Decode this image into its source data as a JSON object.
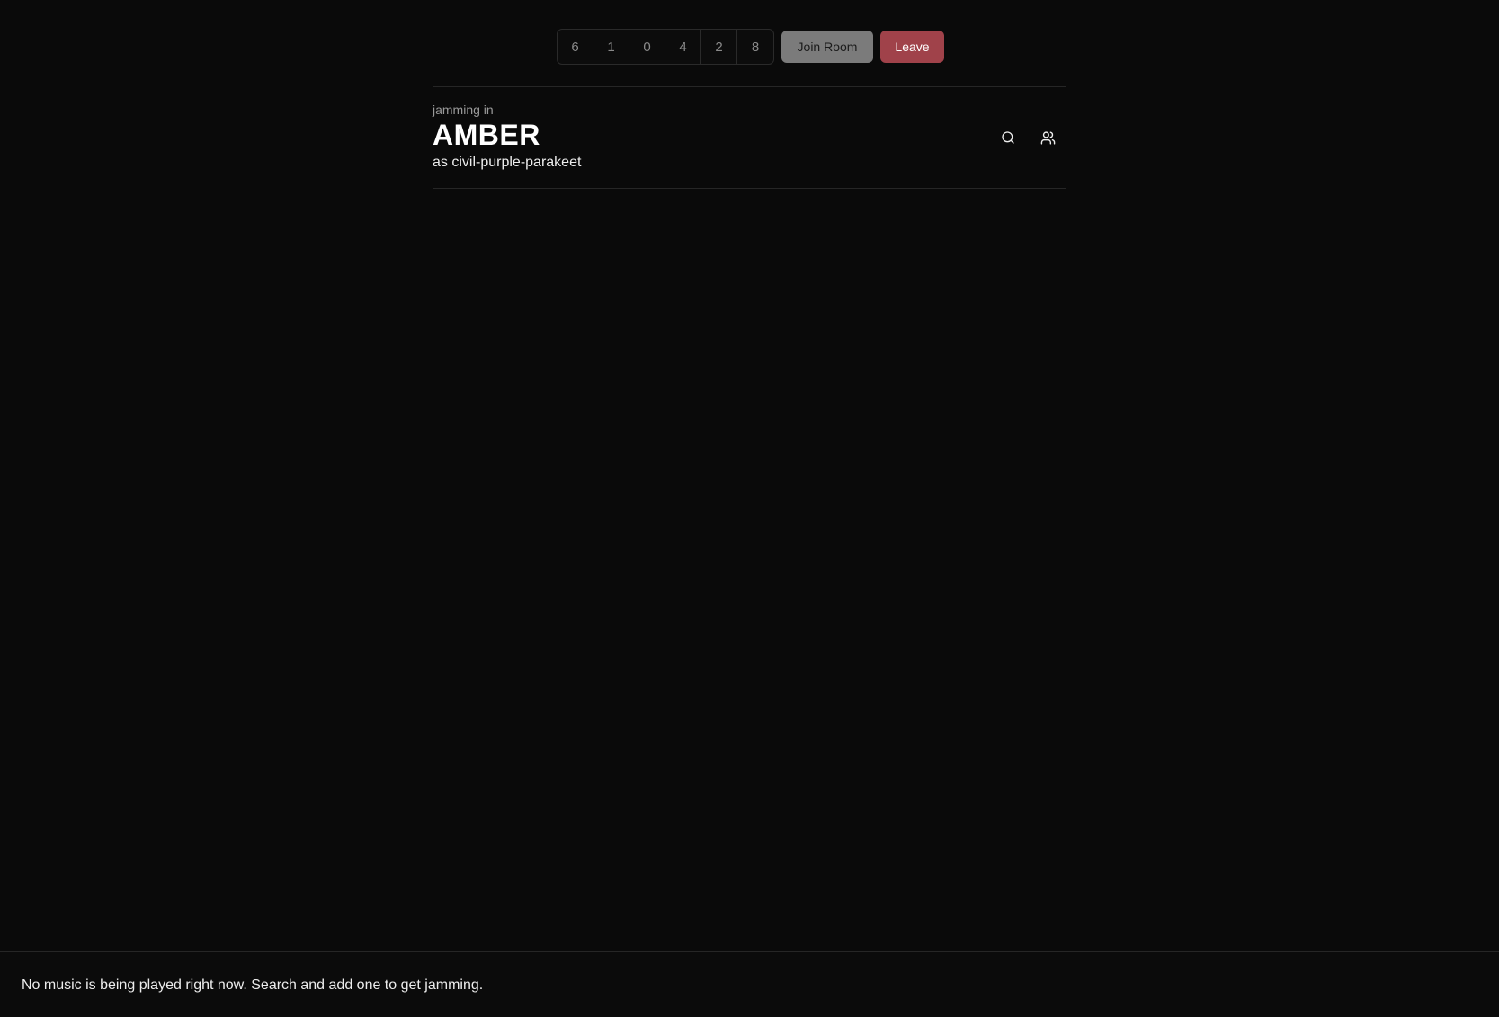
{
  "join_bar": {
    "room_code_digits": [
      "6",
      "1",
      "0",
      "4",
      "2",
      "8"
    ],
    "join_label": "Join Room",
    "leave_label": "Leave"
  },
  "header": {
    "context_label": "jamming in",
    "room_name": "AMBER",
    "user_line": "as civil-purple-parakeet",
    "icons": [
      "search-icon",
      "users-icon"
    ]
  },
  "player": {
    "status_text": "No music is being played right now. Search and add one to get jamming."
  },
  "colors": {
    "background": "#0a0a0a",
    "join_button": "#7b7b7b",
    "leave_button": "#a0424a",
    "text": "#ededed",
    "muted_text": "#9a9a9a"
  }
}
